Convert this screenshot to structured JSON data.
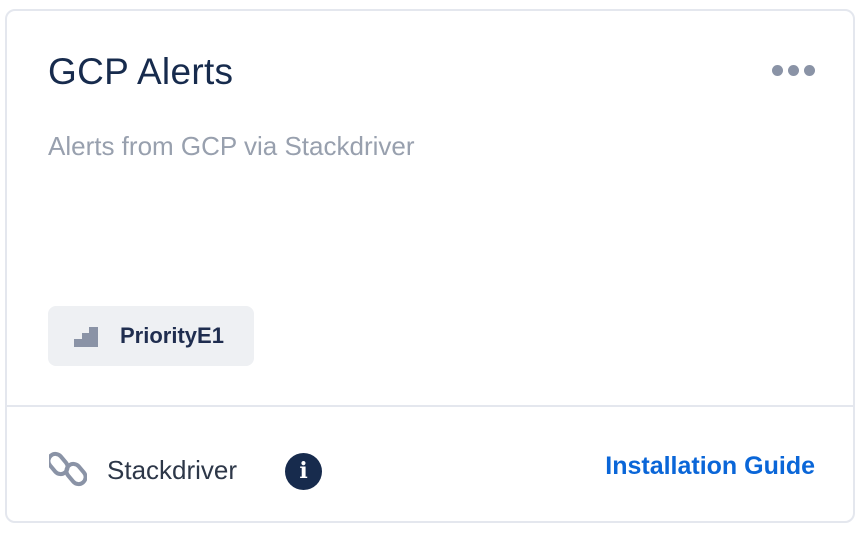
{
  "card": {
    "title": "GCP Alerts",
    "description": "Alerts from GCP via Stackdriver",
    "more_icon": "more-horizontal-icon",
    "priority": {
      "icon": "priority-steps-icon",
      "label": "PriorityE1"
    },
    "footer": {
      "link_icon": "link-chain-icon",
      "integration_name": "Stackdriver",
      "info_icon_glyph": "i",
      "install_label": "Installation Guide"
    }
  },
  "colors": {
    "title": "#172b4d",
    "description": "#98a0ae",
    "accent_link": "#0a66d8",
    "tag_background": "#eef0f3",
    "info_background": "#172b4d"
  }
}
